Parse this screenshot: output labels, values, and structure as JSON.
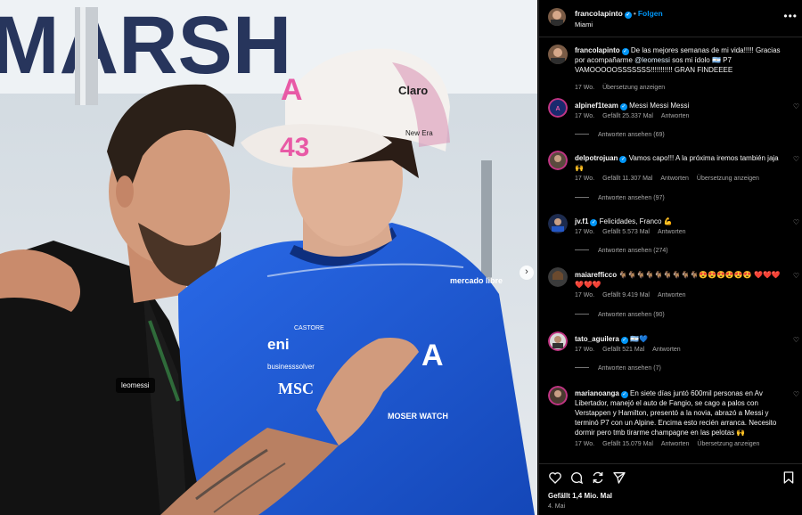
{
  "photo": {
    "banner_text": "MARSH",
    "cap_logo": "A",
    "cap_number": "43",
    "cap_sponsor": "Claro",
    "cap_brand": "New Era",
    "shirt_sponsors": [
      "CASTORE",
      "eni",
      "businesssolver",
      "MSC",
      "mercado libre",
      "MOSER WATCH"
    ],
    "user_tag": "leomessi"
  },
  "post": {
    "username": "francolapinto",
    "follow_label": "Folgen",
    "location": "Miami",
    "caption": {
      "username": "francolapinto",
      "text_before": "De las mejores semanas de mi vida!!!!! Gracias por acompañarme ",
      "mention": "@leomessi",
      "text_after": " sos mi ídolo 🇦🇷 P7 VAMOOOOOSSSSSSS!!!!!!!!!!! GRAN FINDEEEE",
      "age": "17 Wo.",
      "translate": "Übersetzung anzeigen"
    },
    "comments": [
      {
        "username": "alpinef1team",
        "text": "Messi Messi Messi",
        "age": "17 Wo.",
        "likes": "Gefällt 25.337 Mal",
        "reply": "Antworten",
        "translate": "",
        "replies": "Antworten ansehen (69)"
      },
      {
        "username": "delpotrojuan",
        "text": "Vamos capo!!! A la próxima iremos también jaja 🙌",
        "age": "17 Wo.",
        "likes": "Gefällt 11.307 Mal",
        "reply": "Antworten",
        "translate": "Übersetzung anzeigen",
        "replies": "Antworten ansehen (97)"
      },
      {
        "username": "jv.f1",
        "text": "Felicidades, Franco 💪",
        "age": "17 Wo.",
        "likes": "Gefällt 5.573 Mal",
        "reply": "Antworten",
        "translate": "",
        "replies": "Antworten ansehen (274)"
      },
      {
        "username": "maiarefficco",
        "text": "🐐🐐🐐🐐🐐🐐🐐🐐🐐😍😍😍😍😍😍 ❤️❤️❤️❤️❤️❤️",
        "age": "17 Wo.",
        "likes": "Gefällt 9.419 Mal",
        "reply": "Antworten",
        "translate": "",
        "replies": "Antworten ansehen (90)"
      },
      {
        "username": "tato_aguilera",
        "text": "🇦🇷💙",
        "age": "17 Wo.",
        "likes": "Gefällt 521 Mal",
        "reply": "Antworten",
        "translate": "",
        "replies": "Antworten ansehen (7)"
      },
      {
        "username": "marianoanga",
        "text": "En siete días juntó 600mil personas en Av Libertador, manejó el auto de Fangio, se cago a palos con Verstappen y Hamilton, presentó a la novia, abrazó a Messi y terminó P7 con un Alpine. Encima esto recién arranca. Necesito dormir pero tmb tirarme champagne en las pelotas 🙌",
        "age": "17 Wo.",
        "likes": "Gefällt 15.079 Mal",
        "reply": "Antworten",
        "translate": "Übersetzung anzeigen",
        "replies": ""
      }
    ],
    "icons": [
      "heart-icon",
      "comment-icon",
      "share-icon",
      "send-icon",
      "bookmark-icon"
    ],
    "likes_total": "Gefällt 1,4 Mio. Mal",
    "date": "4. Mai"
  },
  "colors": {
    "background": "#000000",
    "link_blue": "#0095f6",
    "muted": "#a8a8a8",
    "alpine_blue": "#1e5bd8",
    "cap_pink": "#e85aa6"
  }
}
